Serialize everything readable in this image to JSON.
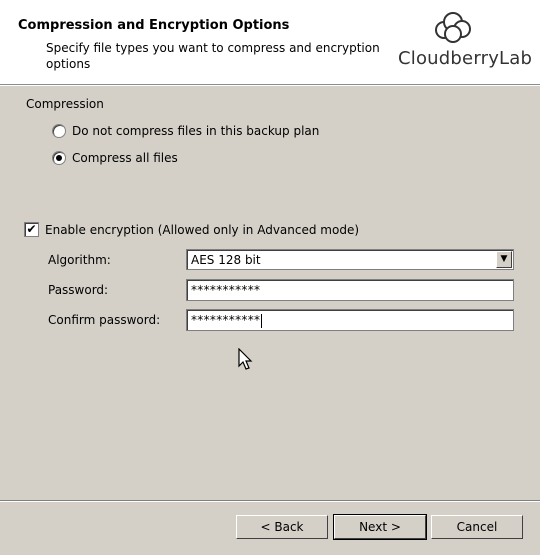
{
  "header": {
    "title": "Compression and Encryption Options",
    "subtitle": "Specify file types you want to compress and encryption options",
    "logo_text": "CloudberryLab"
  },
  "compression": {
    "label": "Compression",
    "options": [
      {
        "label": "Do not compress files in this backup plan",
        "selected": false
      },
      {
        "label": "Compress all files",
        "selected": true
      }
    ]
  },
  "encryption": {
    "enable_label": "Enable encryption (Allowed only in Advanced mode)",
    "enabled": true,
    "algorithm_label": "Algorithm:",
    "algorithm_value": "AES 128 bit",
    "password_label": "Password:",
    "password_value": "***********",
    "confirm_label": "Confirm password:",
    "confirm_value": "***********"
  },
  "buttons": {
    "back": "< Back",
    "next": "Next >",
    "cancel": "Cancel"
  }
}
